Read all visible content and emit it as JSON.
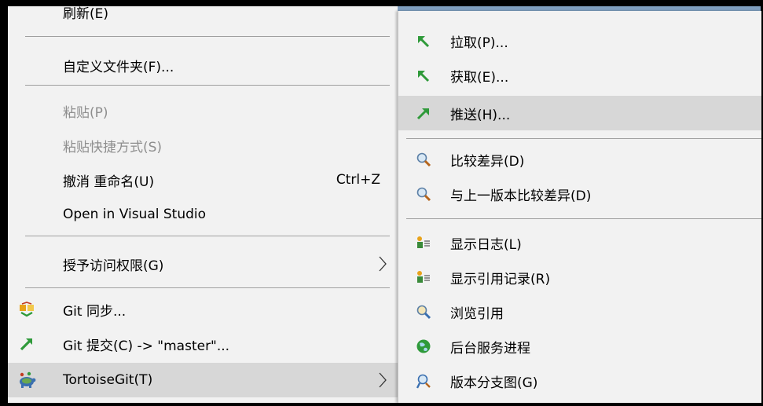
{
  "left_menu": {
    "refresh": "刷新(E)",
    "customize_folder": "自定义文件夹(F)...",
    "paste": "粘贴(P)",
    "paste_shortcut": "粘贴快捷方式(S)",
    "undo_rename": "撤消 重命名(U)",
    "undo_shortcut": "Ctrl+Z",
    "open_in_vs": "Open in Visual Studio",
    "grant_access": "授予访问权限(G)",
    "git_sync": "Git 同步...",
    "git_commit": "Git 提交(C) -> \"master\"...",
    "tortoisegit": "TortoiseGit(T)"
  },
  "right_menu": {
    "pull": "拉取(P)...",
    "fetch": "获取(E)...",
    "push": "推送(H)...",
    "diff": "比较差异(D)",
    "diff_prev": "与上一版本比较差异(D)",
    "show_log": "显示日志(L)",
    "show_reflog": "显示引用记录(R)",
    "browse_refs": "浏览引用",
    "daemon": "后台服务进程",
    "revision_graph": "版本分支图(G)"
  },
  "colors": {
    "menu_bg": "#f2f2f2",
    "highlight": "#d7d7d7",
    "disabled_text": "#8e8e8e",
    "git_green": "#2f9a3a"
  }
}
